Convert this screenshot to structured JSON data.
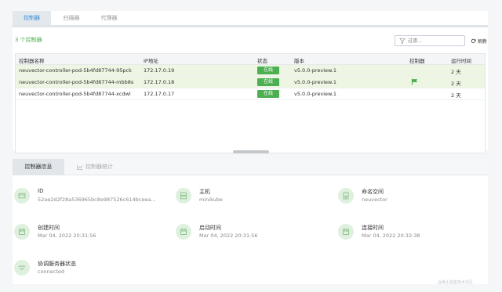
{
  "tabs": [
    {
      "label": "控制器"
    },
    {
      "label": "扫描器"
    },
    {
      "label": "代理器"
    }
  ],
  "controller_count": "3 个控制器",
  "filter": {
    "placeholder": "过滤..."
  },
  "refresh_label": "刷新",
  "table": {
    "headers": [
      "控制器名称",
      "IP地址",
      "状态",
      "版本",
      "控制器",
      "运行时间"
    ],
    "rows": [
      {
        "name": "neuvector-controller-pod-5b4fd87744-95pck",
        "ip": "172.17.0.19",
        "status": "在线",
        "version": "v5.0.0-preview.1",
        "leader": false,
        "uptime": "2 天",
        "selected": true
      },
      {
        "name": "neuvector-controller-pod-5b4fd87744-mbb8s",
        "ip": "172.17.0.18",
        "status": "在线",
        "version": "v5.0.0-preview.1",
        "leader": true,
        "uptime": "2 天",
        "selected": true
      },
      {
        "name": "neuvector-controller-pod-5b4fd87744-xcdwl",
        "ip": "172.17.0.17",
        "status": "在线",
        "version": "v5.0.0-preview.1",
        "leader": false,
        "uptime": "2 天",
        "selected": false
      }
    ]
  },
  "bottom_tabs": [
    {
      "label": "控制器信息"
    },
    {
      "label": "控制器统计"
    }
  ],
  "info": {
    "id": {
      "label": "ID",
      "value": "52ae2d2f28a536965bc8e987526c614bceea..."
    },
    "host": {
      "label": "主机",
      "value": "minikube"
    },
    "namespace": {
      "label": "命名空间",
      "value": "neuvector"
    },
    "created": {
      "label": "创建时间",
      "value": "Mar 04, 2022 20:31:56"
    },
    "started": {
      "label": "启动时间",
      "value": "Mar 04, 2022 20:31:56"
    },
    "joined": {
      "label": "连接时间",
      "value": "Mar 04, 2022 20:32:38"
    },
    "orchestrator": {
      "label": "协调服务器状态",
      "value": "connected"
    }
  },
  "watermark": "@稀土掘金技术社区",
  "colors": {
    "accent": "#4caf50",
    "tab_active_text": "#3b8fd6",
    "selected_row": "#edf6e2"
  }
}
